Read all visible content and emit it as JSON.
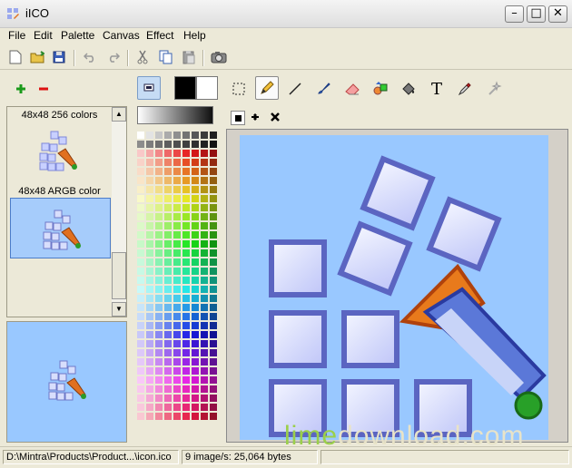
{
  "window": {
    "title": "iICO"
  },
  "menu": [
    "File",
    "Edit",
    "Palette",
    "Canvas",
    "Effect",
    "Help"
  ],
  "toolbar": {
    "icons": [
      "new-icon",
      "open-icon",
      "save-icon",
      "undo-icon",
      "redo-icon",
      "cut-icon",
      "copy-icon",
      "paste-icon",
      "camera-icon"
    ]
  },
  "formats": {
    "items": [
      {
        "label": "48x48 256 colors"
      },
      {
        "label": "48x48 ARGB color",
        "selected": true
      }
    ]
  },
  "status": {
    "path": "D:\\Mintra\\Products\\Product...\\icon.ico",
    "info": "9 image/s: 25,064 bytes"
  },
  "watermark": {
    "part1": "lime",
    "part2": "download",
    "part3": ".com"
  },
  "colors": {
    "accent": "#316ac5",
    "canvas_bg": "#99c8ff",
    "primary": "#000000",
    "secondary": "#ffffff"
  }
}
